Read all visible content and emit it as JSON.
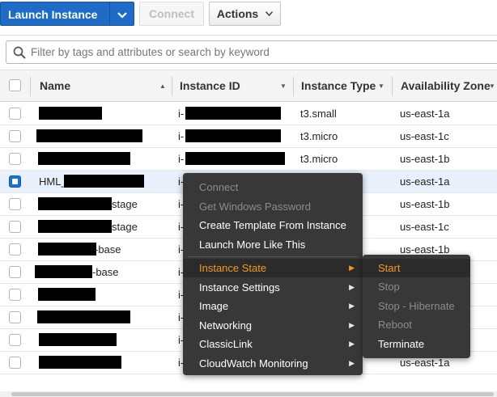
{
  "toolbar": {
    "launch_label": "Launch Instance",
    "connect_label": "Connect",
    "actions_label": "Actions"
  },
  "search": {
    "placeholder": "Filter by tags and attributes or search by keyword"
  },
  "table": {
    "columns": [
      "Name",
      "Instance ID",
      "Instance Type",
      "Availability Zone"
    ],
    "rows": [
      {
        "name": "",
        "id_prefix": "i-",
        "type": "t3.small",
        "zone": "us-east-1a",
        "selected": false
      },
      {
        "name": "",
        "id_prefix": "i-",
        "type": "t3.micro",
        "zone": "us-east-1c",
        "selected": false
      },
      {
        "name": "",
        "id_prefix": "i-",
        "type": "t3.micro",
        "zone": "us-east-1b",
        "selected": false
      },
      {
        "name": "HML_",
        "id_prefix": "i-",
        "type": "",
        "zone": "us-east-1a",
        "selected": true
      },
      {
        "name": "stage",
        "id_prefix": "i-",
        "type": "",
        "zone": "us-east-1b",
        "selected": false
      },
      {
        "name": "stage",
        "id_prefix": "i-",
        "type": "",
        "zone": "us-east-1c",
        "selected": false
      },
      {
        "name": "-base",
        "id_prefix": "i-",
        "type": "",
        "zone": "us-east-1b",
        "selected": false
      },
      {
        "name": "-base",
        "id_prefix": "i-",
        "type": "",
        "zone": "",
        "selected": false
      },
      {
        "name": "",
        "id_prefix": "i-",
        "type": "",
        "zone": "",
        "selected": false
      },
      {
        "name": "",
        "id_prefix": "i-",
        "type": "",
        "zone": "",
        "selected": false
      },
      {
        "name": "",
        "id_prefix": "i-",
        "type": "",
        "zone": "",
        "selected": false
      },
      {
        "name": "",
        "id_prefix": "i-",
        "type": "",
        "zone": "us-east-1a",
        "selected": false
      }
    ]
  },
  "context_menu": {
    "items": [
      {
        "label": "Connect",
        "disabled": true,
        "submenu": false
      },
      {
        "label": "Get Windows Password",
        "disabled": true,
        "submenu": false
      },
      {
        "label": "Create Template From Instance",
        "disabled": false,
        "submenu": false
      },
      {
        "label": "Launch More Like This",
        "disabled": false,
        "submenu": false
      },
      {
        "label": "Instance State",
        "disabled": false,
        "submenu": true,
        "active": true
      },
      {
        "label": "Instance Settings",
        "disabled": false,
        "submenu": true
      },
      {
        "label": "Image",
        "disabled": false,
        "submenu": true
      },
      {
        "label": "Networking",
        "disabled": false,
        "submenu": true
      },
      {
        "label": "ClassicLink",
        "disabled": false,
        "submenu": true
      },
      {
        "label": "CloudWatch Monitoring",
        "disabled": false,
        "submenu": true
      }
    ]
  },
  "instance_state_submenu": {
    "items": [
      {
        "label": "Start",
        "disabled": false,
        "active": true
      },
      {
        "label": "Stop",
        "disabled": true
      },
      {
        "label": "Stop - Hibernate",
        "disabled": true
      },
      {
        "label": "Reboot",
        "disabled": true
      },
      {
        "label": "Terminate",
        "disabled": false
      }
    ]
  },
  "colors": {
    "primary": "#1f6cc6",
    "menu_bg": "#383838",
    "menu_highlight": "#f29a1c",
    "selected_row": "#e8f1fb"
  },
  "icons": {
    "search": "search-icon",
    "caret": "caret-down-icon",
    "submenu_arrow": "chevron-right-icon"
  }
}
